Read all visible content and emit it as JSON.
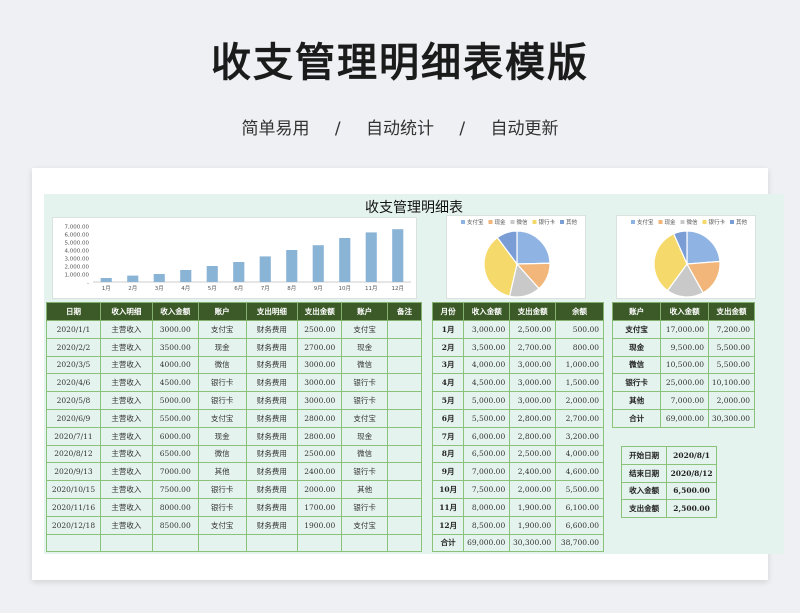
{
  "header": {
    "title": "收支管理明细表模版",
    "tags": [
      "简单易用",
      "/",
      "自动统计",
      "/",
      "自动更新"
    ]
  },
  "sheet": {
    "title": "收支管理明细表"
  },
  "chart_data": [
    {
      "type": "bar",
      "categories": [
        "1月",
        "2月",
        "3月",
        "4月",
        "5月",
        "6月",
        "7月",
        "8月",
        "9月",
        "10月",
        "11月",
        "12月"
      ],
      "values": [
        500,
        800,
        1000,
        1500,
        2000,
        2500,
        3200,
        4000,
        4600,
        5500,
        6200,
        6600
      ],
      "yticks": [
        "7,000.00",
        "6,000.00",
        "5,000.00",
        "4,000.00",
        "3,000.00",
        "2,000.00",
        "1,000.00",
        "-"
      ],
      "ylim": [
        0,
        7000
      ],
      "color": "#8ab4d6"
    },
    {
      "type": "pie",
      "legend": [
        "支付宝",
        "现金",
        "微信",
        "银行卡",
        "其他"
      ],
      "values": [
        17000,
        9500,
        10500,
        25000,
        7000
      ],
      "colors": [
        "#8fb4e3",
        "#f2b67a",
        "#c9c9c9",
        "#f5d96b",
        "#7a9dd6"
      ]
    },
    {
      "type": "pie",
      "legend": [
        "支付宝",
        "现金",
        "微信",
        "银行卡",
        "其他"
      ],
      "values": [
        7200,
        5500,
        5500,
        10100,
        2000
      ],
      "colors": [
        "#8fb4e3",
        "#f2b67a",
        "#c9c9c9",
        "#f5d96b",
        "#7a9dd6"
      ]
    }
  ],
  "detail_table": {
    "headers": [
      "日期",
      "收入明细",
      "收入金额",
      "账户",
      "支出明细",
      "支出金额",
      "账户",
      "备注"
    ],
    "rows": [
      [
        "2020/1/1",
        "主营收入",
        "3000.00",
        "支付宝",
        "财务费用",
        "2500.00",
        "支付宝",
        ""
      ],
      [
        "2020/2/2",
        "主营收入",
        "3500.00",
        "现金",
        "财务费用",
        "2700.00",
        "现金",
        ""
      ],
      [
        "2020/3/5",
        "主营收入",
        "4000.00",
        "微信",
        "财务费用",
        "3000.00",
        "微信",
        ""
      ],
      [
        "2020/4/6",
        "主营收入",
        "4500.00",
        "银行卡",
        "财务费用",
        "3000.00",
        "银行卡",
        ""
      ],
      [
        "2020/5/8",
        "主营收入",
        "5000.00",
        "银行卡",
        "财务费用",
        "3000.00",
        "银行卡",
        ""
      ],
      [
        "2020/6/9",
        "主营收入",
        "5500.00",
        "支付宝",
        "财务费用",
        "2800.00",
        "支付宝",
        ""
      ],
      [
        "2020/7/11",
        "主营收入",
        "6000.00",
        "现金",
        "财务费用",
        "2800.00",
        "现金",
        ""
      ],
      [
        "2020/8/12",
        "主营收入",
        "6500.00",
        "微信",
        "财务费用",
        "2500.00",
        "微信",
        ""
      ],
      [
        "2020/9/13",
        "主营收入",
        "7000.00",
        "其他",
        "财务费用",
        "2400.00",
        "银行卡",
        ""
      ],
      [
        "2020/10/15",
        "主营收入",
        "7500.00",
        "银行卡",
        "财务费用",
        "2000.00",
        "其他",
        ""
      ],
      [
        "2020/11/16",
        "主营收入",
        "8000.00",
        "银行卡",
        "财务费用",
        "1700.00",
        "银行卡",
        ""
      ],
      [
        "2020/12/18",
        "主营收入",
        "8500.00",
        "支付宝",
        "财务费用",
        "1900.00",
        "支付宝",
        ""
      ],
      [
        "",
        "",
        "",
        "",
        "",
        "",
        "",
        ""
      ]
    ]
  },
  "monthly_table": {
    "headers": [
      "月份",
      "收入金额",
      "支出金额",
      "余额"
    ],
    "rows": [
      [
        "1月",
        "3,000.00",
        "2,500.00",
        "500.00"
      ],
      [
        "2月",
        "3,500.00",
        "2,700.00",
        "800.00"
      ],
      [
        "3月",
        "4,000.00",
        "3,000.00",
        "1,000.00"
      ],
      [
        "4月",
        "4,500.00",
        "3,000.00",
        "1,500.00"
      ],
      [
        "5月",
        "5,000.00",
        "3,000.00",
        "2,000.00"
      ],
      [
        "6月",
        "5,500.00",
        "2,800.00",
        "2,700.00"
      ],
      [
        "7月",
        "6,000.00",
        "2,800.00",
        "3,200.00"
      ],
      [
        "8月",
        "6,500.00",
        "2,500.00",
        "4,000.00"
      ],
      [
        "9月",
        "7,000.00",
        "2,400.00",
        "4,600.00"
      ],
      [
        "10月",
        "7,500.00",
        "2,000.00",
        "5,500.00"
      ],
      [
        "11月",
        "8,000.00",
        "1,900.00",
        "6,100.00"
      ],
      [
        "12月",
        "8,500.00",
        "1,900.00",
        "6,600.00"
      ],
      [
        "合计",
        "69,000.00",
        "30,300.00",
        "38,700.00"
      ]
    ]
  },
  "account_table": {
    "headers": [
      "账户",
      "收入金额",
      "支出金额"
    ],
    "rows": [
      [
        "支付宝",
        "17,000.00",
        "7,200.00"
      ],
      [
        "现金",
        "9,500.00",
        "5,500.00"
      ],
      [
        "微信",
        "10,500.00",
        "5,500.00"
      ],
      [
        "银行卡",
        "25,000.00",
        "10,100.00"
      ],
      [
        "其他",
        "7,000.00",
        "2,000.00"
      ],
      [
        "合计",
        "69,000.00",
        "30,300.00"
      ]
    ]
  },
  "summary_table": {
    "rows": [
      [
        "开始日期",
        "2020/8/1"
      ],
      [
        "结束日期",
        "2020/8/12"
      ],
      [
        "收入金额",
        "6,500.00"
      ],
      [
        "支出金额",
        "2,500.00"
      ]
    ]
  }
}
